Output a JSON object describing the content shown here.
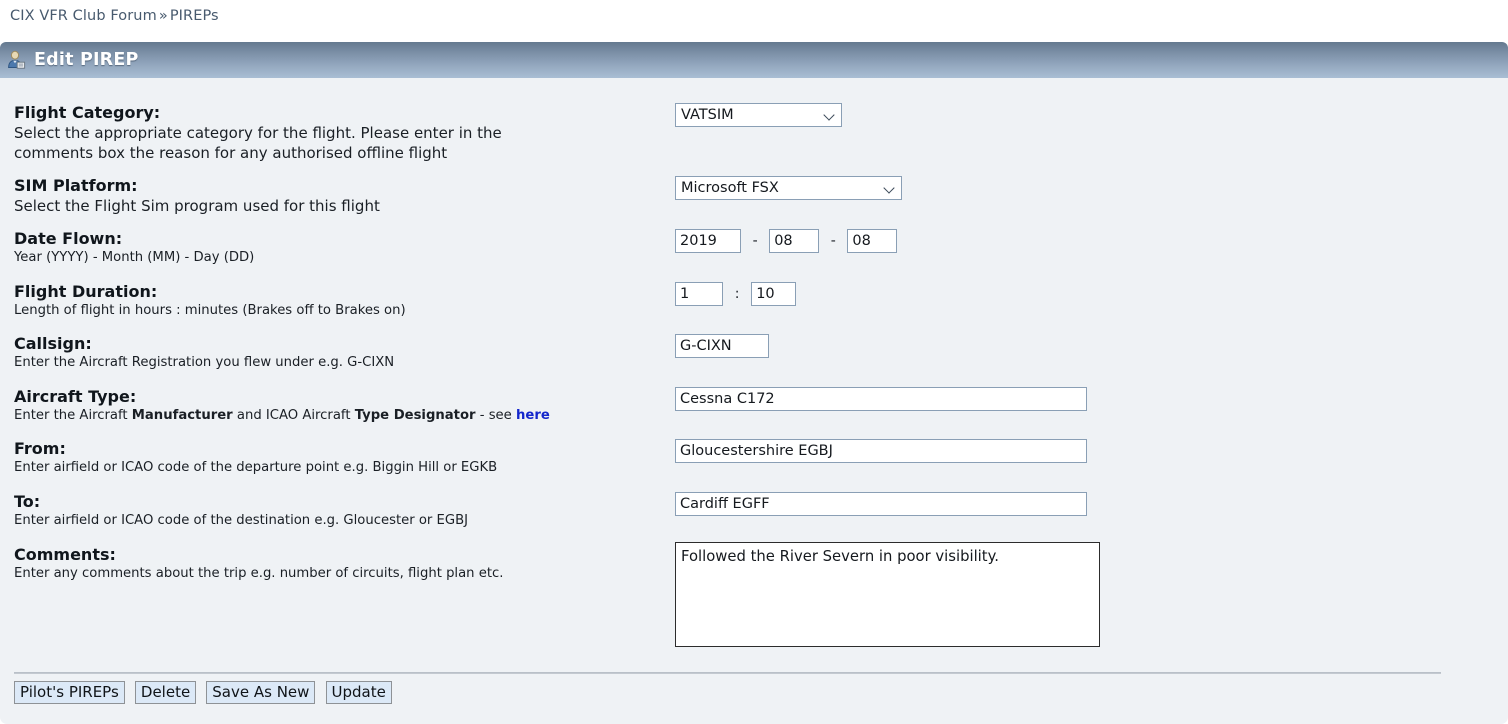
{
  "breadcrumb": {
    "root": "CIX VFR Club Forum",
    "separator": "»",
    "current": "PIREPs"
  },
  "header": {
    "title": "Edit PIREP",
    "icon": "user-avatar-icon",
    "gradient_top": "#64798f",
    "gradient_bottom": "#a9bed4",
    "text_color": "#ffffff"
  },
  "panel": {
    "background": "#eff2f5"
  },
  "fields": {
    "flight_category": {
      "label": "Flight Category:",
      "description": "Select the appropriate category for the flight. Please enter in the comments box the reason for any authorised offline flight",
      "value": "VATSIM",
      "options": [
        "VATSIM"
      ]
    },
    "sim_platform": {
      "label": "SIM Platform:",
      "description": "Select the Flight Sim program used for this flight",
      "value": "Microsoft FSX",
      "options": [
        "Microsoft FSX"
      ]
    },
    "date_flown": {
      "label": "Date Flown:",
      "description": "Year (YYYY) - Month (MM) - Day (DD)",
      "year": "2019",
      "month": "08",
      "day": "08",
      "separator": "-"
    },
    "flight_duration": {
      "label": "Flight Duration:",
      "description": "Length of flight in hours : minutes (Brakes off to Brakes on)",
      "hours": "1",
      "minutes": "10",
      "separator": ":"
    },
    "callsign": {
      "label": "Callsign:",
      "description": "Enter the Aircraft Registration you flew under e.g. G-CIXN",
      "value": "G-CIXN"
    },
    "aircraft_type": {
      "label": "Aircraft Type:",
      "desc_part1": "Enter the Aircraft ",
      "desc_bold1": "Manufacturer",
      "desc_part2": " and ICAO Aircraft ",
      "desc_bold2": "Type Designator",
      "desc_part3": " - see ",
      "desc_link": "here",
      "link_color": "#1326cc",
      "value": "Cessna C172"
    },
    "from": {
      "label": "From:",
      "description": "Enter airfield or ICAO code of the departure point e.g. Biggin Hill or EGKB",
      "value": "Gloucestershire EGBJ"
    },
    "to": {
      "label": "To:",
      "description": "Enter airfield or ICAO code of the destination e.g. Gloucester or EGBJ",
      "value": "Cardiff EGFF"
    },
    "comments": {
      "label": "Comments:",
      "description": "Enter any comments about the trip e.g. number of circuits, flight plan etc.",
      "value": "Followed the River Severn in poor visibility."
    }
  },
  "buttons": {
    "pilots_pireps": "Pilot's PIREPs",
    "delete": "Delete",
    "save_as_new": "Save As New",
    "update": "Update"
  }
}
